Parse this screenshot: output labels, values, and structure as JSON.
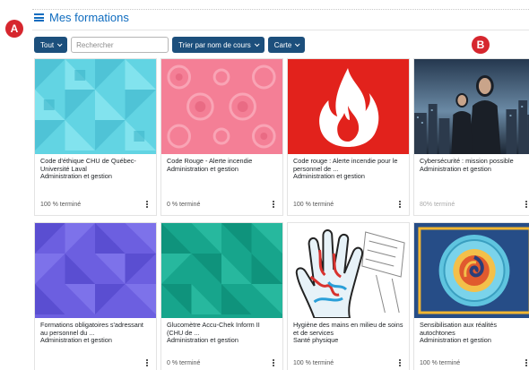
{
  "header": {
    "title": "Mes formations"
  },
  "markers": {
    "a": "A",
    "b": "B"
  },
  "toolbar": {
    "filter_label": "Tout",
    "search_placeholder": "Rechercher",
    "sort_label": "Trier par nom de cours",
    "view_label": "Carte"
  },
  "courses": [
    {
      "title": "Code d'éthique CHU de Québec-Université Laval",
      "category": "Administration et gestion",
      "progress": "100 % terminé",
      "thumb": "cyan-geometric"
    },
    {
      "title": "Code Rouge - Alerte incendie",
      "category": "Administration et gestion",
      "progress": "0 % terminé",
      "thumb": "pink-circles"
    },
    {
      "title": "Code rouge : Alerte incendie pour le personnel de ...",
      "category": "Administration et gestion",
      "progress": "100 % terminé",
      "thumb": "fire-red"
    },
    {
      "title": "Cybersécurité : mission possible",
      "category": "Administration et gestion",
      "progress": "80% terminé",
      "thumb": "cyber-photo"
    },
    {
      "title": "Formations obligatoires s'adressant au personnel du ...",
      "category": "Administration et gestion",
      "progress": "",
      "thumb": "purple-geometric"
    },
    {
      "title": "Glucomètre Accu-Chek Inform II (CHU de ...",
      "category": "Administration et gestion",
      "progress": "0 % terminé",
      "thumb": "teal-geometric"
    },
    {
      "title": "Hygiène des mains en milieu de soins et de services",
      "category": "Santé physique",
      "progress": "100 % terminé",
      "thumb": "hand-drawing"
    },
    {
      "title": "Sensibilisation aux réalités autochtones",
      "category": "Administration et gestion",
      "progress": "100 % terminé",
      "thumb": "medallion"
    }
  ],
  "colors": {
    "link": "#0f6cbf",
    "button": "#1c4f7c",
    "marker": "#d6262e"
  }
}
